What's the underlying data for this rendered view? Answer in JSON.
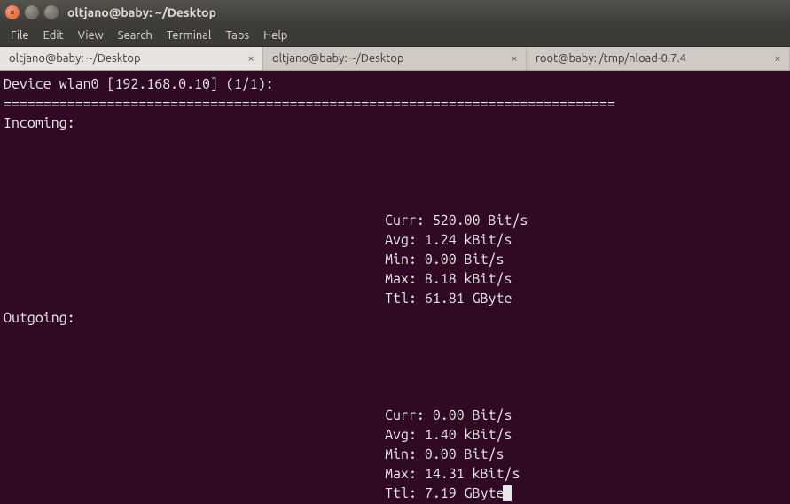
{
  "window": {
    "title": "oltjano@baby: ~/Desktop"
  },
  "menubar": {
    "items": [
      "File",
      "Edit",
      "View",
      "Search",
      "Terminal",
      "Tabs",
      "Help"
    ]
  },
  "tabs": [
    {
      "label": "oltjano@baby: ~/Desktop",
      "active": true
    },
    {
      "label": "oltjano@baby: ~/Desktop",
      "active": false
    },
    {
      "label": "root@baby: /tmp/nload-0.7.4",
      "active": false
    }
  ],
  "nload": {
    "device_line": "Device wlan0 [192.168.0.10] (1/1):",
    "separator": "=============================================================================",
    "incoming_label": "Incoming:",
    "outgoing_label": "Outgoing:",
    "incoming": {
      "curr": "Curr: 520.00 Bit/s",
      "avg": "Avg: 1.24 kBit/s",
      "min": "Min: 0.00 Bit/s",
      "max": "Max: 8.18 kBit/s",
      "ttl": "Ttl: 61.81 GByte"
    },
    "outgoing": {
      "curr": "Curr: 0.00 Bit/s",
      "avg": "Avg: 1.40 kBit/s",
      "min": "Min: 0.00 Bit/s",
      "max": "Max: 14.31 kBit/s",
      "ttl": "Ttl: 7.19 GByte"
    }
  }
}
